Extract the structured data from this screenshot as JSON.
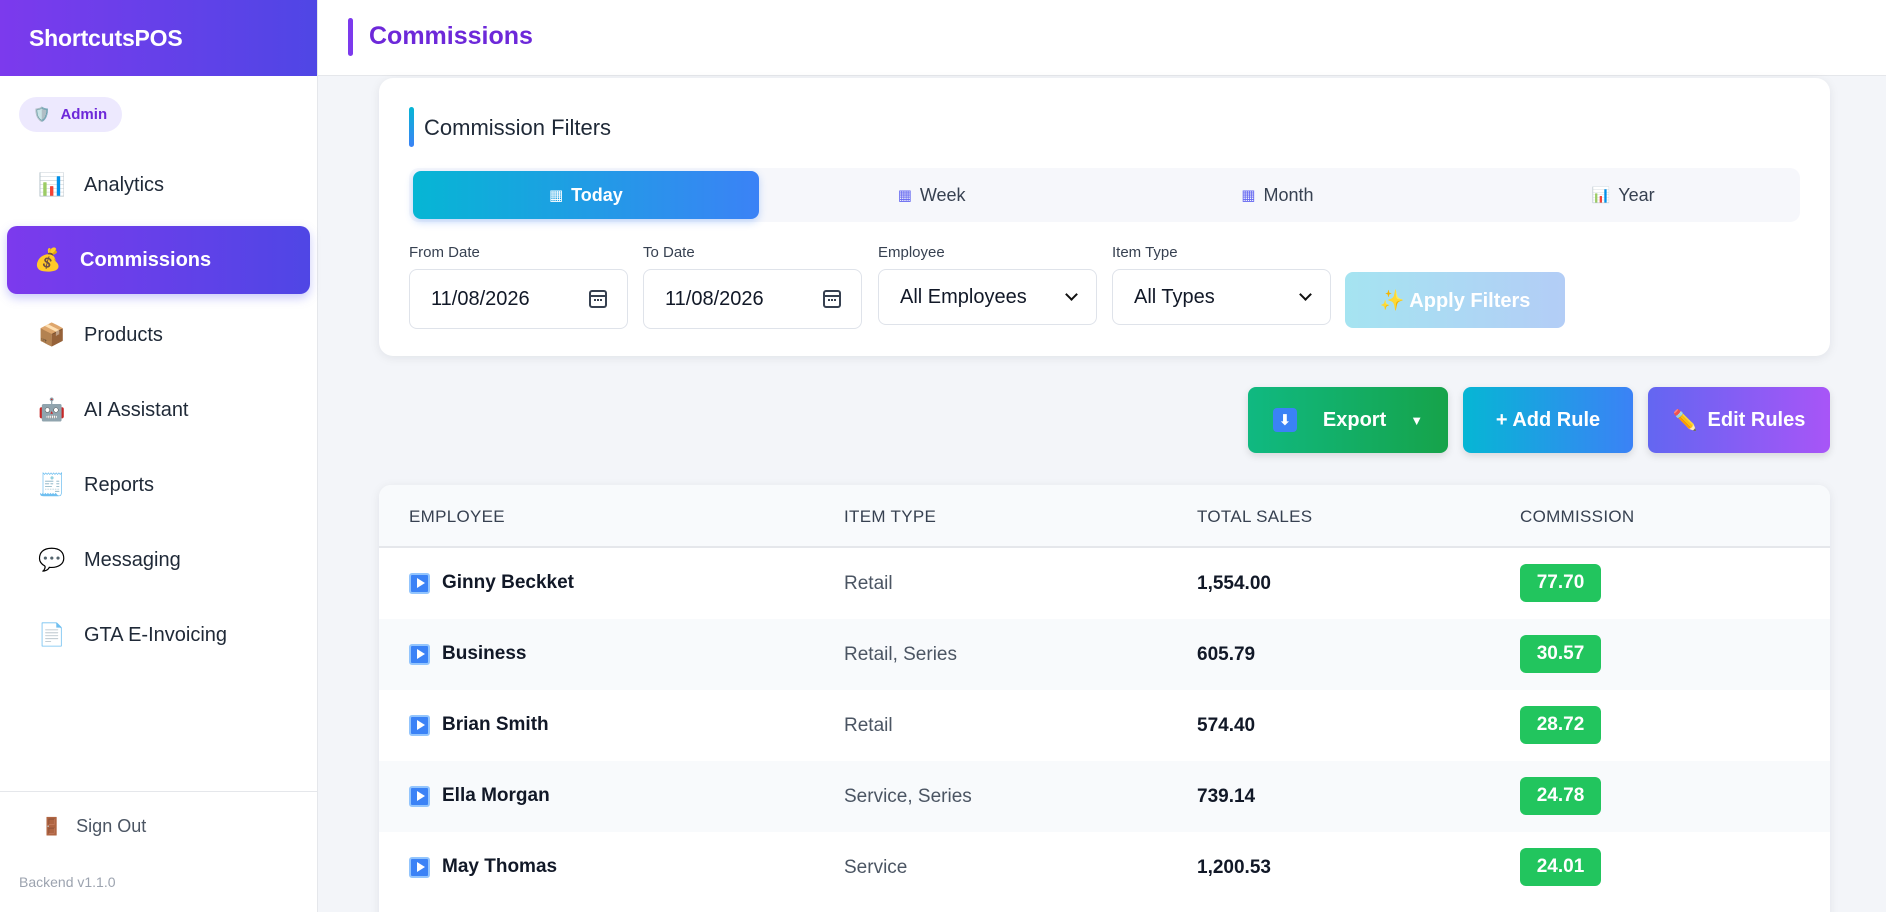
{
  "app": {
    "brand": "ShortcutsPOS",
    "page_title": "Commissions"
  },
  "sidebar": {
    "role": "Admin",
    "items": [
      {
        "label": "Analytics",
        "icon": "bar-chart-icon",
        "glyph": "📊",
        "active": false
      },
      {
        "label": "Commissions",
        "icon": "money-bag-icon",
        "glyph": "💰",
        "active": true
      },
      {
        "label": "Products",
        "icon": "package-icon",
        "glyph": "📦",
        "active": false
      },
      {
        "label": "AI Assistant",
        "icon": "robot-icon",
        "glyph": "🤖",
        "active": false
      },
      {
        "label": "Reports",
        "icon": "report-icon",
        "glyph": "🧾",
        "active": false
      },
      {
        "label": "Messaging",
        "icon": "speech-bubble-icon",
        "glyph": "💬",
        "active": false
      },
      {
        "label": "GTA E-Invoicing",
        "icon": "invoice-icon",
        "glyph": "📄",
        "active": false
      }
    ],
    "sign_out": "Sign Out",
    "version": "Backend v1.1.0"
  },
  "filters": {
    "title": "Commission Filters",
    "periods": [
      {
        "label": "Today",
        "active": true
      },
      {
        "label": "Week",
        "active": false
      },
      {
        "label": "Month",
        "active": false
      },
      {
        "label": "Year",
        "active": false
      }
    ],
    "from_date_label": "From Date",
    "from_date": "11/08/2026",
    "to_date_label": "To Date",
    "to_date": "11/08/2026",
    "employee_label": "Employee",
    "employee_value": "All Employees",
    "item_type_label": "Item Type",
    "item_type_value": "All Types",
    "apply": "✨ Apply Filters"
  },
  "actions": {
    "export": "Export",
    "add_rule": "+ Add Rule",
    "edit_rules": "Edit Rules"
  },
  "table": {
    "headers": [
      "EMPLOYEE",
      "ITEM TYPE",
      "TOTAL SALES",
      "COMMISSION"
    ],
    "rows": [
      {
        "employee": "Ginny Beckket",
        "item_type": "Retail",
        "total_sales": "1,554.00",
        "commission": "77.70"
      },
      {
        "employee": "Business",
        "item_type": "Retail, Series",
        "total_sales": "605.79",
        "commission": "30.57"
      },
      {
        "employee": "Brian Smith",
        "item_type": "Retail",
        "total_sales": "574.40",
        "commission": "28.72"
      },
      {
        "employee": "Ella Morgan",
        "item_type": "Service, Series",
        "total_sales": "739.14",
        "commission": "24.78"
      },
      {
        "employee": "May Thomas",
        "item_type": "Service",
        "total_sales": "1,200.53",
        "commission": "24.01"
      }
    ]
  },
  "colors": {
    "brand_purple": "#7c3aed",
    "brand_indigo": "#4f46e5",
    "accent_cyan": "#06b6d4",
    "accent_blue": "#3b82f6",
    "success_green": "#22c55e"
  }
}
